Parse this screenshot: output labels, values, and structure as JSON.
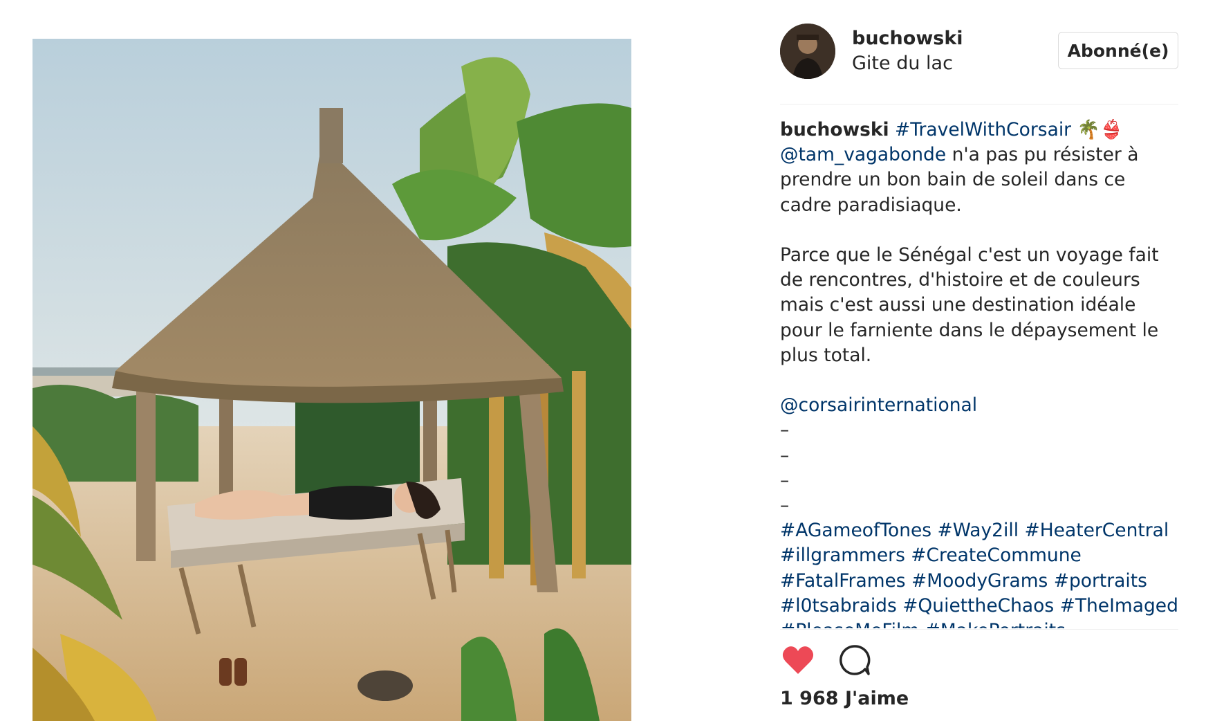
{
  "post": {
    "image_alt": "Woman in black swimsuit lounging on a daybed under a thatched hut surrounded by banana trees",
    "author": {
      "username": "buchowski",
      "location": "Gite du lac",
      "follow_label": "Abonné(e)"
    },
    "caption": {
      "username": "buchowski",
      "hashtag_main": "#TravelWithCorsair",
      "emojis": "🌴👙",
      "mention": "@tam_vagabonde",
      "line1_rest": " n'a pas pu résister à",
      "line2": "prendre un bon bain de soleil dans ce",
      "line3": "cadre paradisiaque.",
      "para2": [
        "Parce que le Sénégal c'est un voyage fait",
        "de rencontres, d'histoire et de couleurs",
        "mais c'est aussi une destination idéale",
        "pour le farniente dans le dépaysement le",
        "plus total."
      ],
      "mention2": "@corsairinternational",
      "dashes": [
        "–",
        "–",
        "–",
        "–"
      ],
      "hashtag_lines": [
        "#AGameofTones #Way2ill #HeaterCentral",
        "#illgrammers #CreateCommune",
        "#FatalFrames #MoodyGrams #portraits",
        "#l0tsabraids #QuiettheChaos #TheImaged",
        "#PleaseMeFilm #MakePortraits"
      ]
    },
    "likes_label": "1 968 J'aime",
    "icons": [
      "heart-icon",
      "comment-icon"
    ],
    "colors": {
      "like_red": "#ed4956",
      "link_blue": "#003569",
      "text": "#262626",
      "border": "#dbdbdb"
    }
  }
}
